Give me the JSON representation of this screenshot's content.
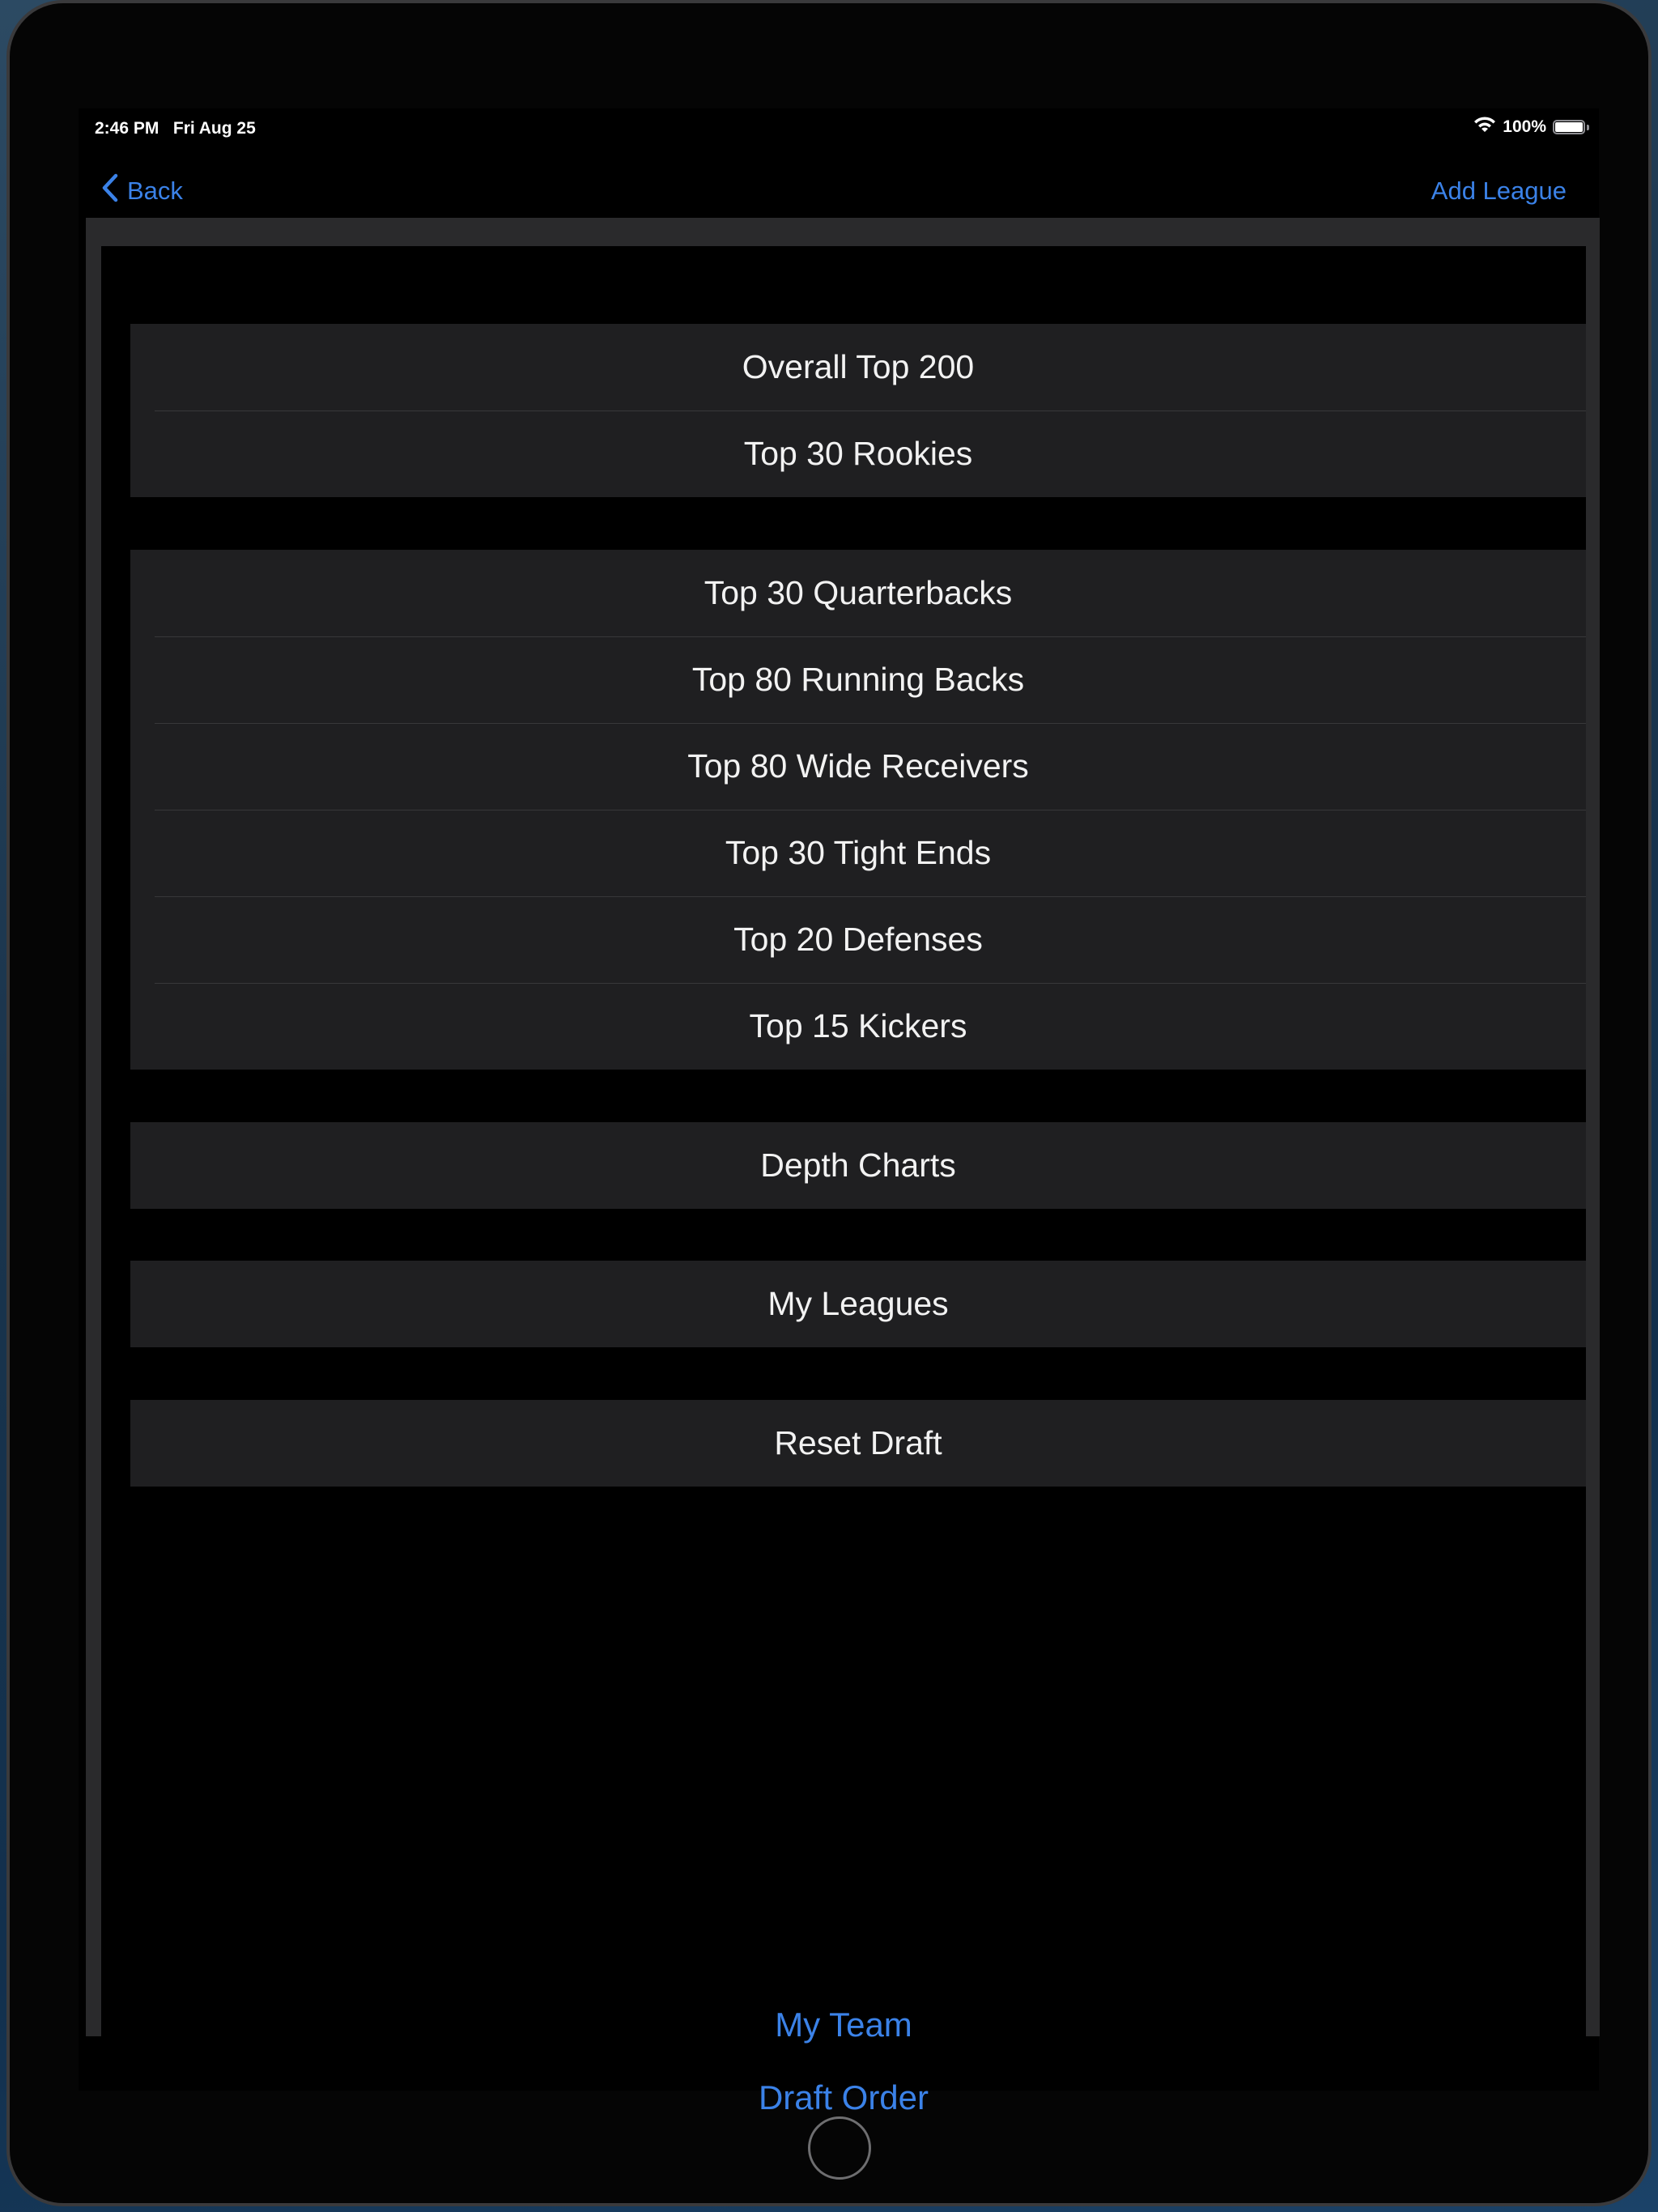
{
  "status_bar": {
    "time": "2:46 PM   Fri Aug 25",
    "battery_text": "100%",
    "battery_level": 1.0
  },
  "nav": {
    "back_label": "Back",
    "add_league_label": "Add League"
  },
  "groups": [
    {
      "items": [
        "Overall Top 200",
        "Top 30 Rookies"
      ]
    },
    {
      "items": [
        "Top 30 Quarterbacks",
        "Top 80 Running Backs",
        "Top 80 Wide Receivers",
        "Top 30 Tight Ends",
        "Top 20 Defenses",
        "Top 15 Kickers"
      ]
    },
    {
      "items": [
        "Depth Charts"
      ]
    },
    {
      "items": [
        "My Leagues"
      ]
    },
    {
      "items": [
        "Reset Draft"
      ]
    }
  ],
  "bottom_links": {
    "my_team": "My Team",
    "draft_order": "Draft Order"
  },
  "colors": {
    "accent": "#3b82e8",
    "row_background": "#1f1f21",
    "background": "#000000"
  }
}
